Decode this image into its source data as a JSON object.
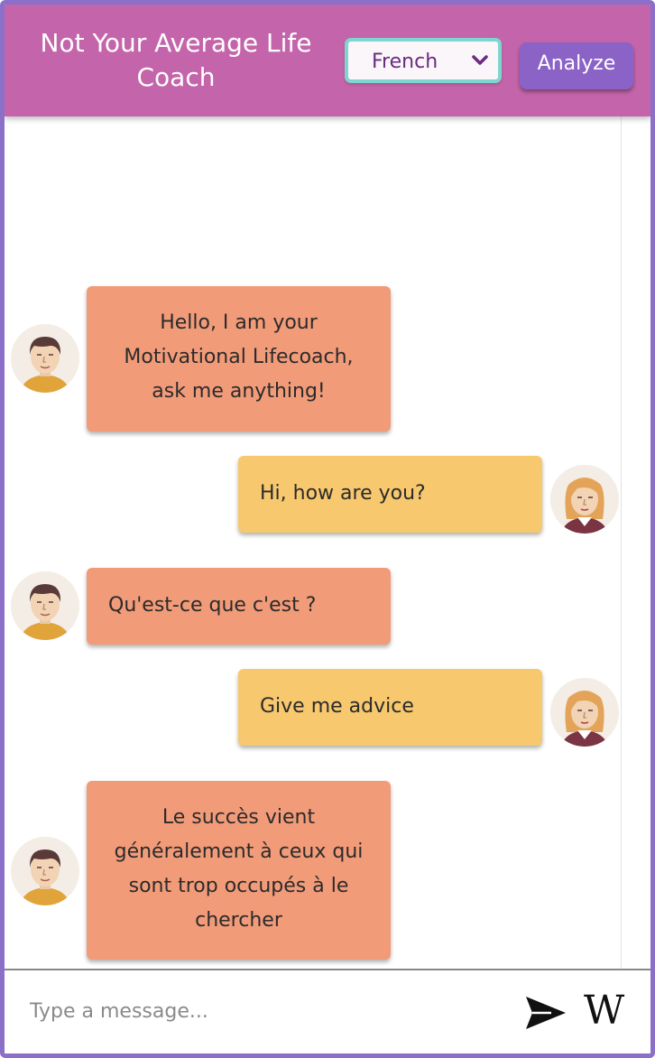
{
  "header": {
    "title": "Not Your Average Life Coach",
    "language_selected": "French",
    "analyze_label": "Analyze"
  },
  "messages": [
    {
      "sender": "bot",
      "text": "Hello, I am your Motivational Lifecoach, ask me anything!"
    },
    {
      "sender": "user",
      "text": "Hi, how are you?"
    },
    {
      "sender": "bot",
      "text": "Qu'est-ce que c'est ?"
    },
    {
      "sender": "user",
      "text": "Give me advice"
    },
    {
      "sender": "bot",
      "text": "Le succès vient généralement à ceux qui sont trop occupés à le chercher"
    }
  ],
  "composer": {
    "placeholder": "Type a message...",
    "send_icon": "send-icon",
    "wiki_icon": "wikipedia-icon",
    "wiki_glyph": "W"
  },
  "colors": {
    "header": "#c465ab",
    "frame": "#8b6fc9",
    "bot_bubble": "#f29b79",
    "user_bubble": "#f7c86e",
    "select_border": "#7fd6d1",
    "analyze_button": "#8b62c6"
  }
}
